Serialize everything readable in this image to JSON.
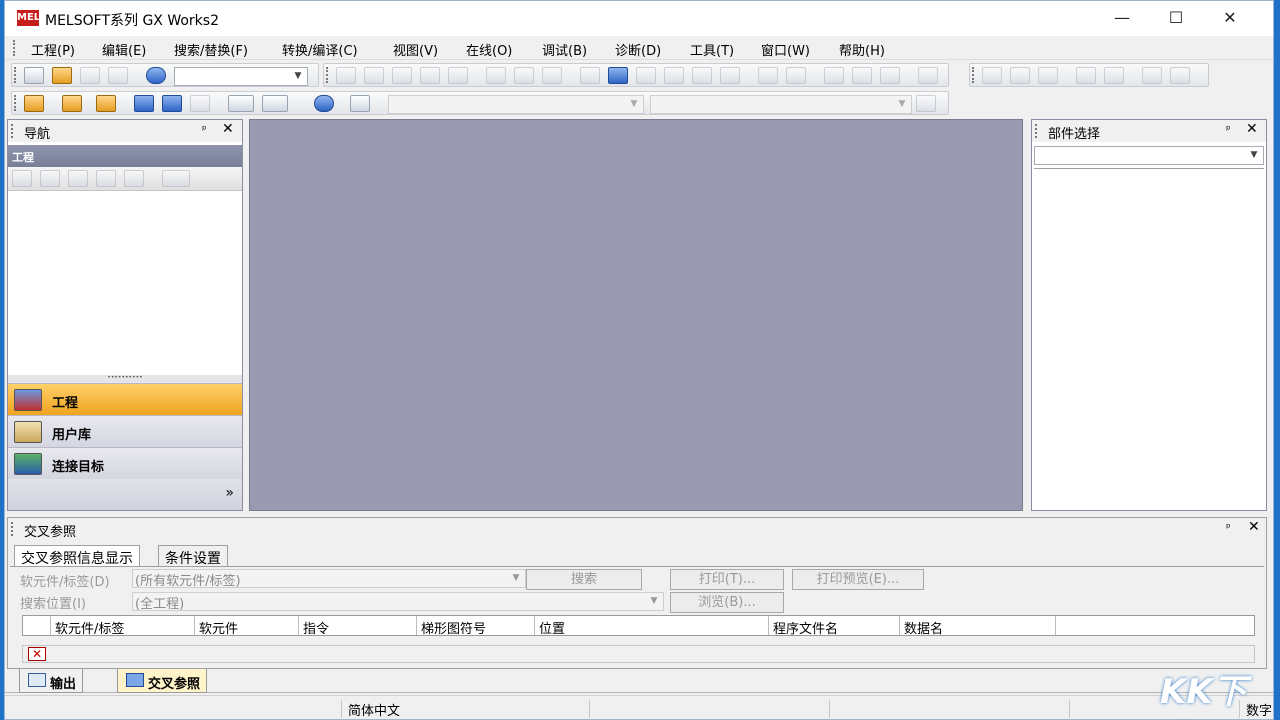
{
  "window": {
    "title": "MELSOFT系列 GX Works2",
    "logo": "MEL",
    "minimize": "—",
    "maximize": "☐",
    "close": "✕"
  },
  "menu": [
    "工程(P)",
    "编辑(E)",
    "搜索/替换(F)",
    "转换/编译(C)",
    "视图(V)",
    "在线(O)",
    "调试(B)",
    "诊断(D)",
    "工具(T)",
    "窗口(W)",
    "帮助(H)"
  ],
  "navigation": {
    "title": "导航",
    "band_label": "工程",
    "buttons": [
      "工程",
      "用户库",
      "连接目标"
    ],
    "more": "»"
  },
  "parts_selection": {
    "title": "部件选择"
  },
  "xref": {
    "title": "交叉参照",
    "tabs": [
      "交叉参照信息显示",
      "条件设置"
    ],
    "device_label": "软元件/标签(D)",
    "device_value": "(所有软元件/标签)",
    "search_pos_label": "搜索位置(I)",
    "search_pos_value": "(全工程)",
    "search_btn": "搜索",
    "print_btn": "打印(T)...",
    "preview_btn": "打印预览(E)...",
    "browse_btn": "浏览(B)...",
    "columns": [
      "软元件/标签",
      "软元件",
      "指令",
      "梯形图符号",
      "位置",
      "程序文件名",
      "数据名"
    ]
  },
  "bottom_tabs": [
    "输出",
    "交叉参照"
  ],
  "status": {
    "ime": "简体中文",
    "right": "数字"
  },
  "pin_glyph": "ᵖ",
  "close_glyph": "✕",
  "watermark": "KK下载"
}
